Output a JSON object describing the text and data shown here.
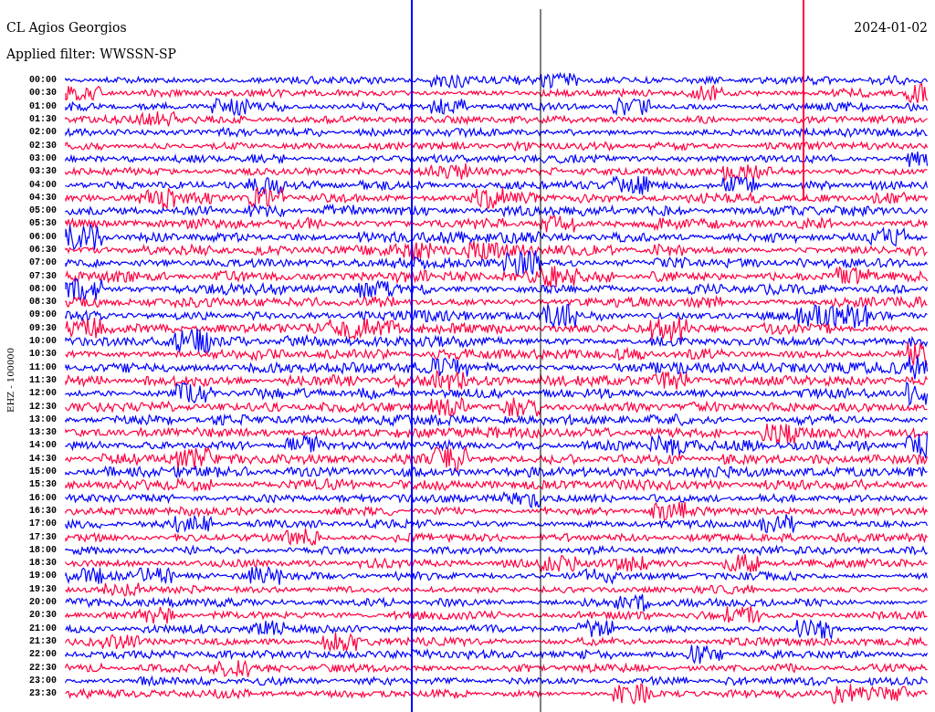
{
  "header": {
    "station": "CL Agios Georgios",
    "date": "2024-01-02",
    "filter": "Applied filter: WWSSN-SP"
  },
  "axis_label": "EHZ - 100000",
  "rows": [
    {
      "time": "00:00",
      "color": "#0000ff"
    },
    {
      "time": "00:30",
      "color": "#ff0040"
    },
    {
      "time": "01:00",
      "color": "#0000ff"
    },
    {
      "time": "01:30",
      "color": "#ff0040"
    },
    {
      "time": "02:00",
      "color": "#0000ff"
    },
    {
      "time": "02:30",
      "color": "#ff0040"
    },
    {
      "time": "03:00",
      "color": "#0000ff"
    },
    {
      "time": "03:30",
      "color": "#ff0040"
    },
    {
      "time": "04:00",
      "color": "#0000ff"
    },
    {
      "time": "04:30",
      "color": "#ff0040"
    },
    {
      "time": "05:00",
      "color": "#0000ff"
    },
    {
      "time": "05:30",
      "color": "#ff0040"
    },
    {
      "time": "06:00",
      "color": "#0000ff"
    },
    {
      "time": "06:30",
      "color": "#ff0040"
    },
    {
      "time": "07:00",
      "color": "#0000ff"
    },
    {
      "time": "07:30",
      "color": "#ff0040"
    },
    {
      "time": "08:00",
      "color": "#0000ff"
    },
    {
      "time": "08:30",
      "color": "#ff0040"
    },
    {
      "time": "09:00",
      "color": "#0000ff"
    },
    {
      "time": "09:30",
      "color": "#ff0040"
    },
    {
      "time": "10:00",
      "color": "#0000ff"
    },
    {
      "time": "10:30",
      "color": "#ff0040"
    },
    {
      "time": "11:00",
      "color": "#0000ff"
    },
    {
      "time": "11:30",
      "color": "#ff0040"
    },
    {
      "time": "12:00",
      "color": "#0000ff"
    },
    {
      "time": "12:30",
      "color": "#ff0040"
    },
    {
      "time": "13:00",
      "color": "#0000ff"
    },
    {
      "time": "13:30",
      "color": "#ff0040"
    },
    {
      "time": "14:00",
      "color": "#0000ff"
    },
    {
      "time": "14:30",
      "color": "#ff0040"
    },
    {
      "time": "15:00",
      "color": "#0000ff"
    },
    {
      "time": "15:30",
      "color": "#ff0040"
    },
    {
      "time": "16:00",
      "color": "#0000ff"
    },
    {
      "time": "16:30",
      "color": "#ff0040"
    },
    {
      "time": "17:00",
      "color": "#0000ff"
    },
    {
      "time": "17:30",
      "color": "#ff0040"
    },
    {
      "time": "18:00",
      "color": "#0000ff"
    },
    {
      "time": "18:30",
      "color": "#ff0040"
    },
    {
      "time": "19:00",
      "color": "#0000ff"
    },
    {
      "time": "19:30",
      "color": "#ff0040"
    },
    {
      "time": "20:00",
      "color": "#0000ff"
    },
    {
      "time": "20:30",
      "color": "#ff0040"
    },
    {
      "time": "21:00",
      "color": "#0000ff"
    },
    {
      "time": "21:30",
      "color": "#ff0040"
    },
    {
      "time": "22:00",
      "color": "#0000ff"
    },
    {
      "time": "22:30",
      "color": "#ff0040"
    },
    {
      "time": "23:00",
      "color": "#0000ff"
    },
    {
      "time": "23:30",
      "color": "#ff0040"
    }
  ]
}
